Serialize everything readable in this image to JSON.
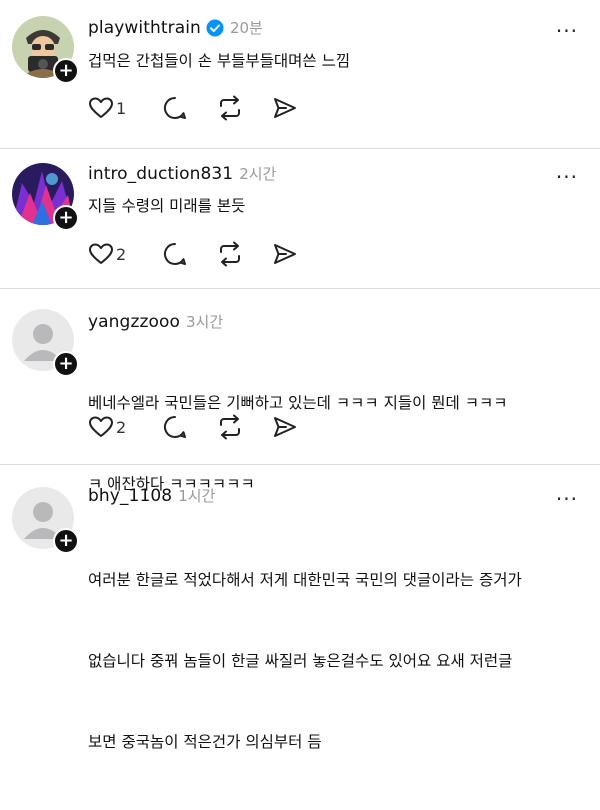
{
  "comments": [
    {
      "username": "playwithtrain",
      "verified": true,
      "time": "20분",
      "text": "겁먹은 간첩들이 손 부들부들대며쓴 느낌",
      "likes": "1",
      "more": "···"
    },
    {
      "username": "intro_duction831",
      "verified": false,
      "time": "2시간",
      "text": "지들 수령의 미래를 본듯",
      "likes": "2",
      "more": "···"
    },
    {
      "username": "yangzzooo",
      "verified": false,
      "time": "3시간",
      "text_lines": [
        "베네수엘라 국민들은 기뻐하고 있는데 ㅋㅋㅋ 지들이 뭔데 ㅋㅋㅋ",
        "ㅋ 애잔하다 ㅋㅋㅋㅋㅋㅋ"
      ],
      "likes": "2",
      "more": "···"
    },
    {
      "username": "bhy_1108",
      "verified": false,
      "time": "1시간",
      "text_lines": [
        "여러분 한글로 적었다해서 저게 대한민국 국민의 댓글이라는 증거가",
        "없습니다 중꿔 놈들이 한글 싸질러 놓은걸수도 있어요 요새 저런글",
        "보면 중국놈이 적은건가 의심부터 듬"
      ],
      "more": "···"
    }
  ],
  "follow_label": "+",
  "colors": {
    "verified": "#0095f6",
    "timestamp": "#9a9a9a",
    "divider": "#dcdcdc"
  },
  "icons": [
    "heart-icon",
    "comment-icon",
    "repost-icon",
    "share-icon",
    "verified-badge-icon",
    "more-icon"
  ]
}
